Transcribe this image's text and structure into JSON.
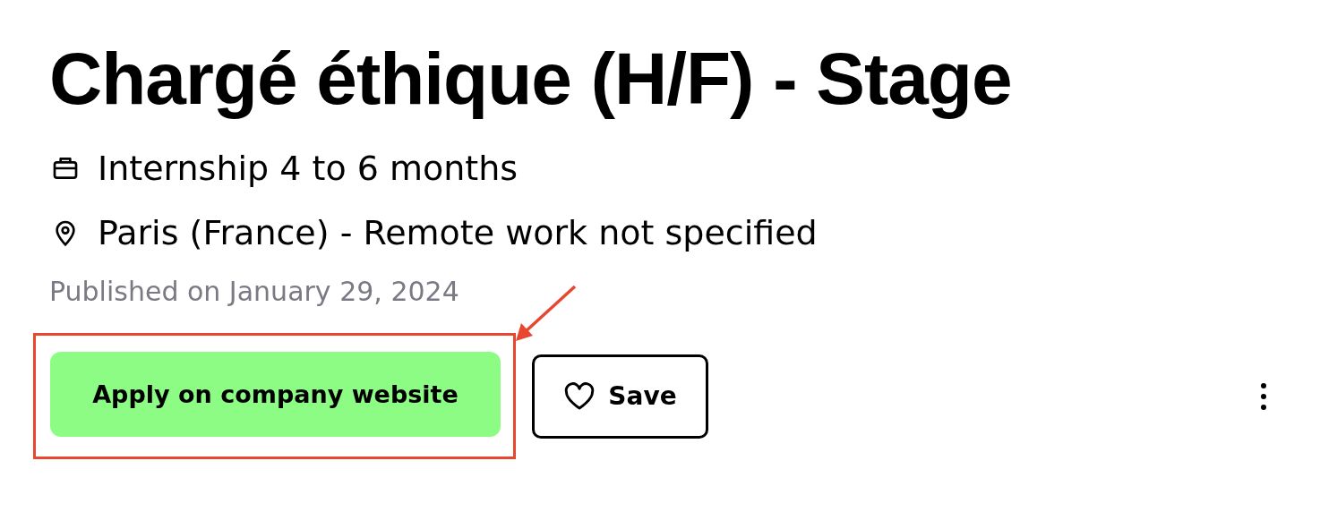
{
  "title": "Chargé éthique (H/F) - Stage",
  "details": [
    {
      "kind": "contract",
      "text": "Internship 4 to 6 months"
    },
    {
      "kind": "location",
      "text": "Paris (France) - Remote work not specified"
    }
  ],
  "published": "Published on January 29, 2024",
  "apply_button": "Apply on company website",
  "save_button": {
    "label": "Save",
    "selected": false
  }
}
